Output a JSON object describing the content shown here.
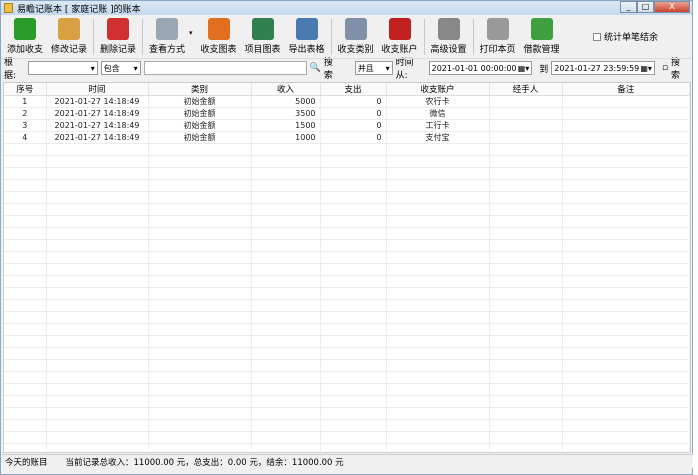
{
  "window": {
    "title": "易瞻记账本  [ 家庭记账 ]的账本",
    "minimize": "_",
    "maximize": "□",
    "close": "X"
  },
  "toolbar": {
    "items": [
      {
        "label": "添加收支",
        "icon": "add-icon",
        "color": "#2a9a2a"
      },
      {
        "label": "修改记录",
        "icon": "pencil-icon",
        "color": "#d8a040"
      },
      {
        "label": "删除记录",
        "icon": "delete-icon",
        "color": "#d03030"
      },
      {
        "label": "查看方式",
        "icon": "document-icon",
        "color": "#9aa6b4"
      },
      {
        "label": "收支图表",
        "icon": "bar-chart-icon",
        "color": "#e07020"
      },
      {
        "label": "项目图表",
        "icon": "pie-chart-icon",
        "color": "#308050"
      },
      {
        "label": "导出表格",
        "icon": "export-icon",
        "color": "#4a7ab0"
      },
      {
        "label": "收支类别",
        "icon": "list-icon",
        "color": "#8090a8"
      },
      {
        "label": "收支账户",
        "icon": "book-icon",
        "color": "#c02020"
      },
      {
        "label": "高级设置",
        "icon": "gear-icon",
        "color": "#888888"
      },
      {
        "label": "打印本页",
        "icon": "printer-icon",
        "color": "#999999"
      },
      {
        "label": "借款管理",
        "icon": "network-icon",
        "color": "#40a040"
      }
    ],
    "stat_checkbox": "统计单笔结余"
  },
  "search": {
    "basis_label": "根据:",
    "basis_value": "",
    "match_value": "包含",
    "keyword": "",
    "search1": "搜索",
    "logic": "并且",
    "time_from_label": "时间从:",
    "time_from": "2021-01-01 00:00:00",
    "to_label": "到",
    "time_to": "2021-01-27 23:59:59",
    "search2": "搜索"
  },
  "table": {
    "columns": [
      "序号",
      "时间",
      "类别",
      "收入",
      "支出",
      "收支账户",
      "经手人",
      "备注"
    ],
    "rows": [
      [
        "1",
        "2021-01-27 14:18:49",
        "初始金额",
        "5000",
        "0",
        "农行卡",
        "",
        ""
      ],
      [
        "2",
        "2021-01-27 14:18:49",
        "初始金额",
        "3500",
        "0",
        "微信",
        "",
        ""
      ],
      [
        "3",
        "2021-01-27 14:18:49",
        "初始金额",
        "1500",
        "0",
        "工行卡",
        "",
        ""
      ],
      [
        "4",
        "2021-01-27 14:18:49",
        "初始金额",
        "1000",
        "0",
        "支付宝",
        "",
        ""
      ]
    ]
  },
  "status": {
    "left": "今天的账目",
    "summary": "当前记录总收入：11000.00 元，总支出：0.00 元，结余：11000.00 元"
  }
}
